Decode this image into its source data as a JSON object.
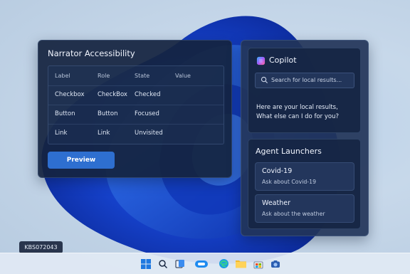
{
  "narrator": {
    "title": "Narrator Accessibility",
    "columns": [
      "Label",
      "Role",
      "State",
      "Value"
    ],
    "rows": [
      [
        "Checkbox",
        "CheckBox",
        "Checked",
        ""
      ],
      [
        "Button",
        "Button",
        "Focused",
        ""
      ],
      [
        "Link",
        "Link",
        "Unvisited",
        ""
      ]
    ],
    "preview_label": "Preview"
  },
  "copilot": {
    "title": "Copilot",
    "search_placeholder": "Search for local results...",
    "message_line1": "Here are your local results,",
    "message_line2": "What else can I do for you?"
  },
  "agents": {
    "title": "Agent Launchers",
    "items": [
      {
        "name": "Covid-19",
        "description": "Ask about Covid-19"
      },
      {
        "name": "Weather",
        "description": "Ask about the weather"
      }
    ]
  },
  "badge": "KBS072043",
  "taskbar": {
    "icons": [
      "windows-start-icon",
      "search-icon",
      "task-view-icon",
      "copilot-icon",
      "edge-icon",
      "file-explorer-icon",
      "store-icon",
      "camera-icon"
    ],
    "colors": {
      "accent": "#2e6fd0",
      "panel": "#142340"
    }
  }
}
